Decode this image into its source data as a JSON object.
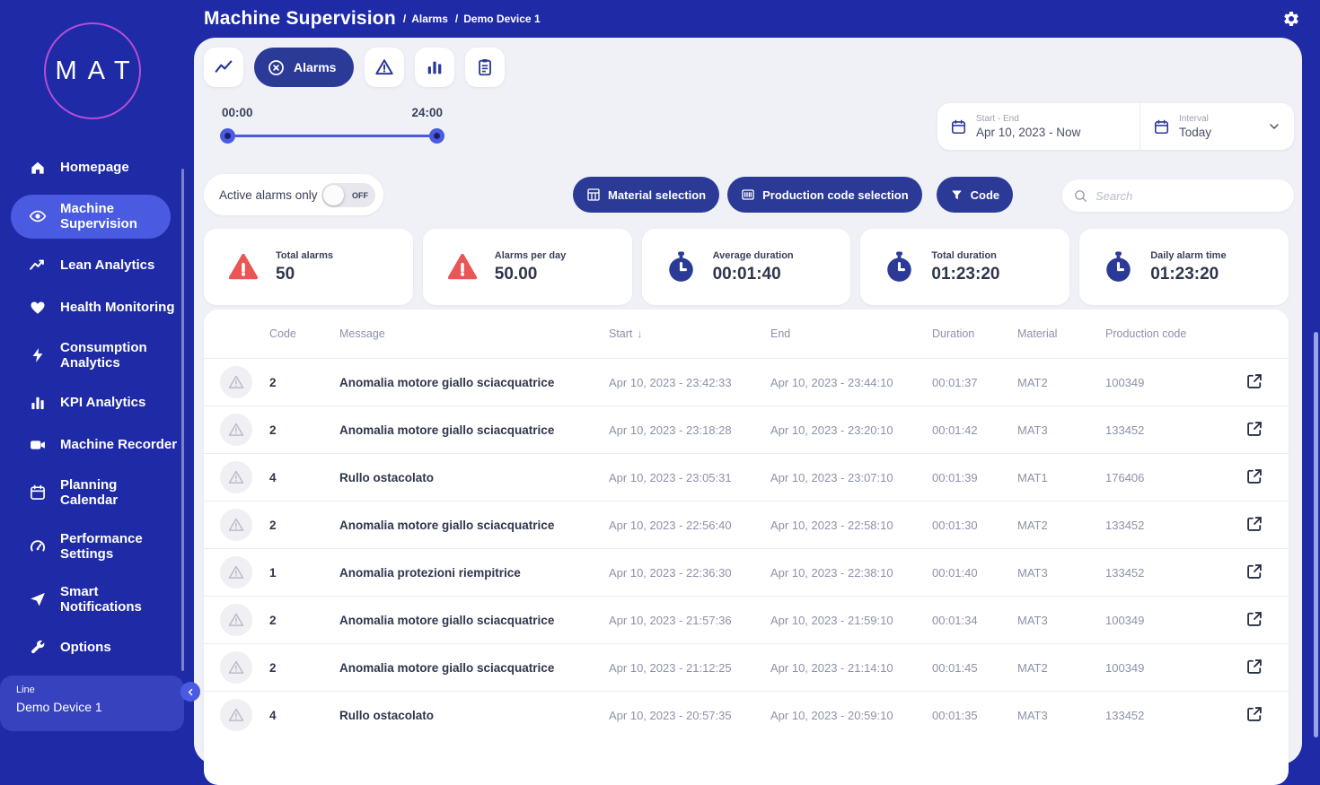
{
  "colors": {
    "background": "#1F2AA6",
    "accent": "#4A5AE1",
    "button_navy": "#2B3A97",
    "panel_background": "#EFF1F7",
    "alert_red": "#EA5555",
    "text_dark": "#2F364B",
    "text_gray": "#8C93A7",
    "logo_ring": "#B44FD6"
  },
  "logo": {
    "text": "MAT"
  },
  "header": {
    "title": "Machine Supervision",
    "separator": "/",
    "breadcrumbs": [
      "Alarms",
      "Demo Device 1"
    ]
  },
  "sidebar": {
    "items": [
      {
        "label": "Homepage",
        "icon": "home-icon",
        "active": false
      },
      {
        "label": "Machine\nSupervision",
        "icon": "eye-icon",
        "active": true
      },
      {
        "label": "Lean Analytics",
        "icon": "trend-icon",
        "active": false
      },
      {
        "label": "Health Monitoring",
        "icon": "heart-icon",
        "active": false
      },
      {
        "label": "Consumption\nAnalytics",
        "icon": "bolt-icon",
        "active": false
      },
      {
        "label": "KPI Analytics",
        "icon": "bar-chart-icon",
        "active": false
      },
      {
        "label": "Machine Recorder",
        "icon": "video-icon",
        "active": false
      },
      {
        "label": "Planning\nCalendar",
        "icon": "calendar-icon",
        "active": false
      },
      {
        "label": "Performance\nSettings",
        "icon": "gauge-icon",
        "active": false
      },
      {
        "label": "Smart\nNotifications",
        "icon": "send-icon",
        "active": false
      },
      {
        "label": "Options",
        "icon": "wrench-icon",
        "active": false
      }
    ],
    "device": {
      "label": "Line",
      "name": "Demo Device 1"
    }
  },
  "toolbar": {
    "alarms_tab_label": "Alarms"
  },
  "time_slider": {
    "start_label": "00:00",
    "end_label": "24:00"
  },
  "date_range": {
    "label": "Start - End",
    "value": "Apr 10, 2023 - Now"
  },
  "interval": {
    "label": "Interval",
    "value": "Today"
  },
  "filters": {
    "active_alarms_label": "Active alarms only",
    "toggle_state": "OFF",
    "material_button": "Material selection",
    "production_button": "Production code selection",
    "code_button": "Code",
    "search_placeholder": "Search"
  },
  "stats": [
    {
      "label": "Total alarms",
      "value": "50",
      "icon": "alert-triangle-icon"
    },
    {
      "label": "Alarms per day",
      "value": "50.00",
      "icon": "alert-triangle-icon"
    },
    {
      "label": "Average duration",
      "value": "00:01:40",
      "icon": "stopwatch-icon"
    },
    {
      "label": "Total duration",
      "value": "01:23:20",
      "icon": "stopwatch-icon"
    },
    {
      "label": "Daily alarm time",
      "value": "01:23:20",
      "icon": "stopwatch-icon"
    }
  ],
  "table": {
    "columns": [
      "Code",
      "Message",
      "Start",
      "End",
      "Duration",
      "Material",
      "Production code"
    ],
    "sort_column": "Start",
    "sort_indicator": "↓",
    "rows": [
      {
        "code": "2",
        "message": "Anomalia motore giallo sciacquatrice",
        "start": "Apr 10, 2023 - 23:42:33",
        "end": "Apr 10, 2023 - 23:44:10",
        "duration": "00:01:37",
        "material": "MAT2",
        "production_code": "100349"
      },
      {
        "code": "2",
        "message": "Anomalia motore giallo sciacquatrice",
        "start": "Apr 10, 2023 - 23:18:28",
        "end": "Apr 10, 2023 - 23:20:10",
        "duration": "00:01:42",
        "material": "MAT3",
        "production_code": "133452"
      },
      {
        "code": "4",
        "message": "Rullo ostacolato",
        "start": "Apr 10, 2023 - 23:05:31",
        "end": "Apr 10, 2023 - 23:07:10",
        "duration": "00:01:39",
        "material": "MAT1",
        "production_code": "176406"
      },
      {
        "code": "2",
        "message": "Anomalia motore giallo sciacquatrice",
        "start": "Apr 10, 2023 - 22:56:40",
        "end": "Apr 10, 2023 - 22:58:10",
        "duration": "00:01:30",
        "material": "MAT2",
        "production_code": "133452"
      },
      {
        "code": "1",
        "message": "Anomalia protezioni riempitrice",
        "start": "Apr 10, 2023 - 22:36:30",
        "end": "Apr 10, 2023 - 22:38:10",
        "duration": "00:01:40",
        "material": "MAT3",
        "production_code": "133452"
      },
      {
        "code": "2",
        "message": "Anomalia motore giallo sciacquatrice",
        "start": "Apr 10, 2023 - 21:57:36",
        "end": "Apr 10, 2023 - 21:59:10",
        "duration": "00:01:34",
        "material": "MAT3",
        "production_code": "100349"
      },
      {
        "code": "2",
        "message": "Anomalia motore giallo sciacquatrice",
        "start": "Apr 10, 2023 - 21:12:25",
        "end": "Apr 10, 2023 - 21:14:10",
        "duration": "00:01:45",
        "material": "MAT2",
        "production_code": "100349"
      },
      {
        "code": "4",
        "message": "Rullo ostacolato",
        "start": "Apr 10, 2023 - 20:57:35",
        "end": "Apr 10, 2023 - 20:59:10",
        "duration": "00:01:35",
        "material": "MAT3",
        "production_code": "133452"
      }
    ]
  }
}
